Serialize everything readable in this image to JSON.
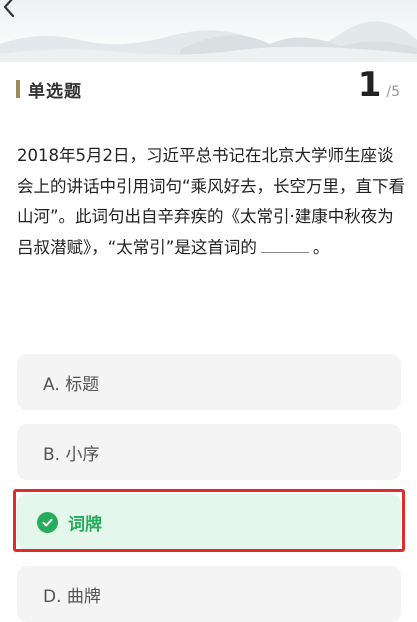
{
  "header": {
    "back_icon": "chevron-left-icon"
  },
  "quiz": {
    "type_label": "单选题",
    "current": "1",
    "total": "/5"
  },
  "question": {
    "text": "2018年5月2日，习近平总书记在北京大学师生座谈会上的讲话中引用词句“乘风好去，长空万里，直下看山河”。此词句出自辛弃疾的《太常引·建康中秋夜为吕叔潜赋》，“太常引”是这首词的",
    "end": "。"
  },
  "options": [
    {
      "label": "A. 标题",
      "selected": false
    },
    {
      "label": "B. 小序",
      "selected": false
    },
    {
      "label": "词牌",
      "selected": true,
      "icon": "check-circle-icon"
    },
    {
      "label": "D. 曲牌",
      "selected": false
    }
  ],
  "colors": {
    "accent_green": "#25ad5c",
    "selected_bg": "#e5f6ec",
    "highlight_red": "#e02b2b",
    "title_bar": "#a08a5c"
  }
}
